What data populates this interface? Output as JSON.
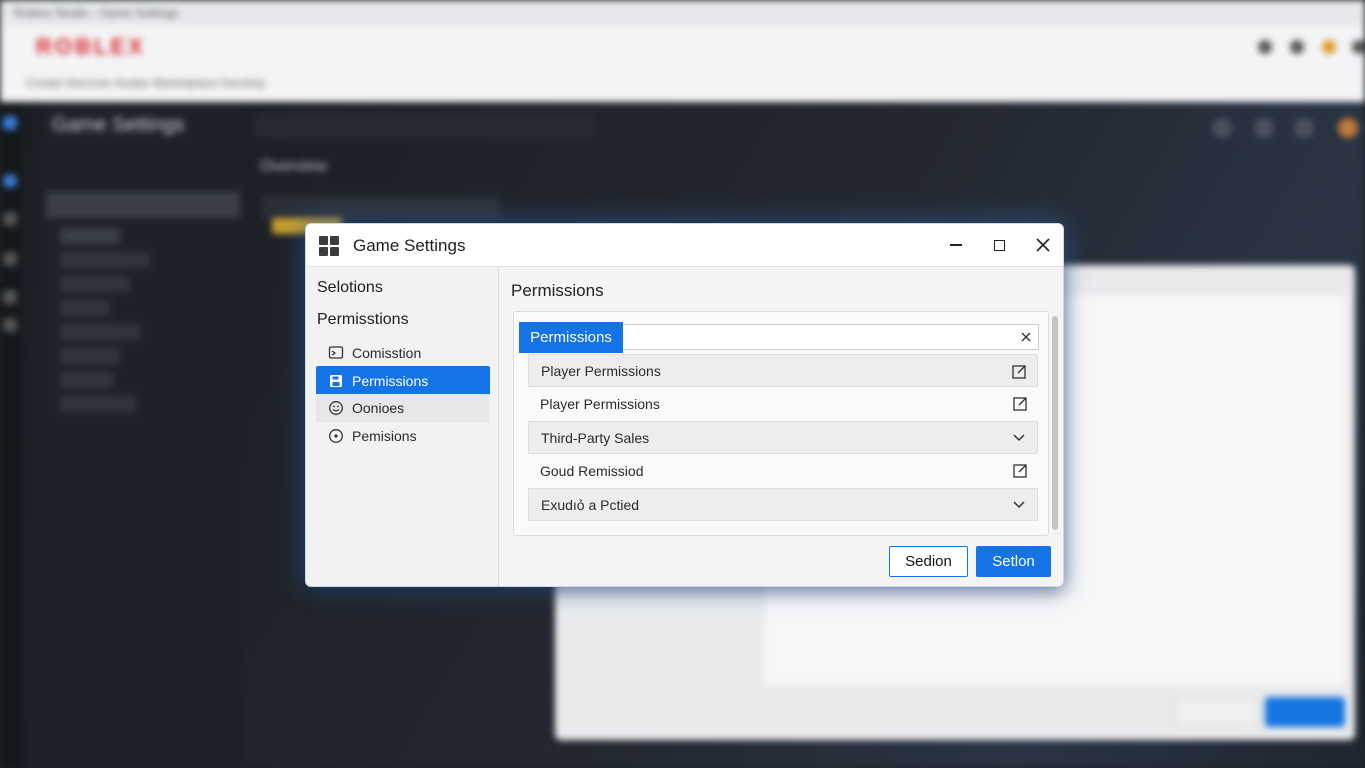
{
  "browser": {
    "tab_title": "Roblox Studio - Game Settings",
    "logo": "ROBLEX",
    "bookmarks": "Create   Discover   Avatar   Marketplace   Develop"
  },
  "studio": {
    "panel_title": "Game Settings",
    "section_heading": "Overview"
  },
  "dialog": {
    "title": "Game Settings",
    "left_pane": {
      "section1": "Selotions",
      "section2": "Permisstions",
      "items": [
        {
          "label": "Comisstion",
          "icon": "message-icon",
          "state": "normal"
        },
        {
          "label": "Permissions",
          "icon": "save-icon",
          "state": "active"
        },
        {
          "label": "Oonioes",
          "icon": "smiley-icon",
          "state": "hover"
        },
        {
          "label": "Pemisions",
          "icon": "target-icon",
          "state": "normal"
        }
      ]
    },
    "right_pane": {
      "title": "Permissions",
      "search_tag": "Permissions",
      "rows": [
        {
          "label": "Player Permissions",
          "icon": "edit-icon"
        },
        {
          "label": "Player Permissions",
          "icon": "edit-icon"
        },
        {
          "label": "Third-Party Sales",
          "icon": "chevron-down-icon"
        },
        {
          "label": "Goud Remissiod",
          "icon": "edit-icon"
        },
        {
          "label": "Exudıỏ a Pctied",
          "icon": "chevron-down-icon"
        }
      ]
    },
    "buttons": {
      "secondary": "Sedion",
      "primary": "Setlon"
    }
  },
  "colors": {
    "accent": "#1473e6",
    "dialog_bg": "#f3f3f3",
    "studio_bg": "#1c2026"
  }
}
